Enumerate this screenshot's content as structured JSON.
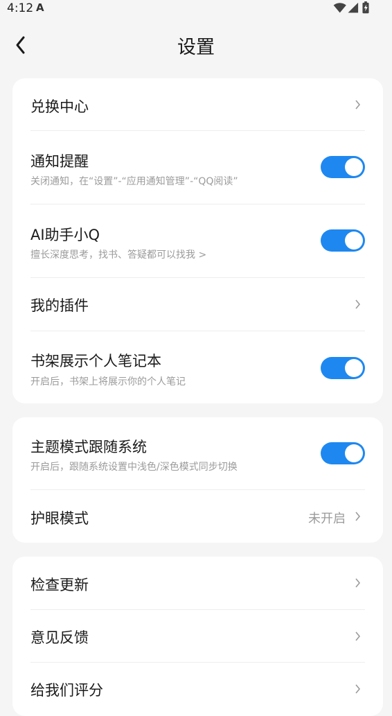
{
  "status_bar": {
    "time": "4:12",
    "app_icon": "A"
  },
  "header": {
    "title": "设置"
  },
  "group1": {
    "redeem": {
      "title": "兑换中心"
    },
    "notify": {
      "title": "通知提醒",
      "subtitle": "关闭通知，在“设置”-“应用通知管理”-“QQ阅读”",
      "enabled": true
    },
    "ai": {
      "title": "AI助手小Q",
      "subtitle": "擅长深度思考，找书、答疑都可以找我 >",
      "enabled": true
    },
    "plugins": {
      "title": "我的插件"
    },
    "notebook": {
      "title": "书架展示个人笔记本",
      "subtitle": "开启后，书架上将展示你的个人笔记",
      "enabled": true
    }
  },
  "group2": {
    "theme": {
      "title": "主题模式跟随系统",
      "subtitle": "开启后，跟随系统设置中浅色/深色模式同步切换",
      "enabled": true
    },
    "eye": {
      "title": "护眼模式",
      "value": "未开启"
    }
  },
  "group3": {
    "update": {
      "title": "检查更新"
    },
    "feedback": {
      "title": "意见反馈"
    },
    "rate": {
      "title": "给我们评分"
    }
  },
  "colors": {
    "accent": "#1e88f0",
    "background": "#f5f5f5",
    "card": "#ffffff"
  }
}
